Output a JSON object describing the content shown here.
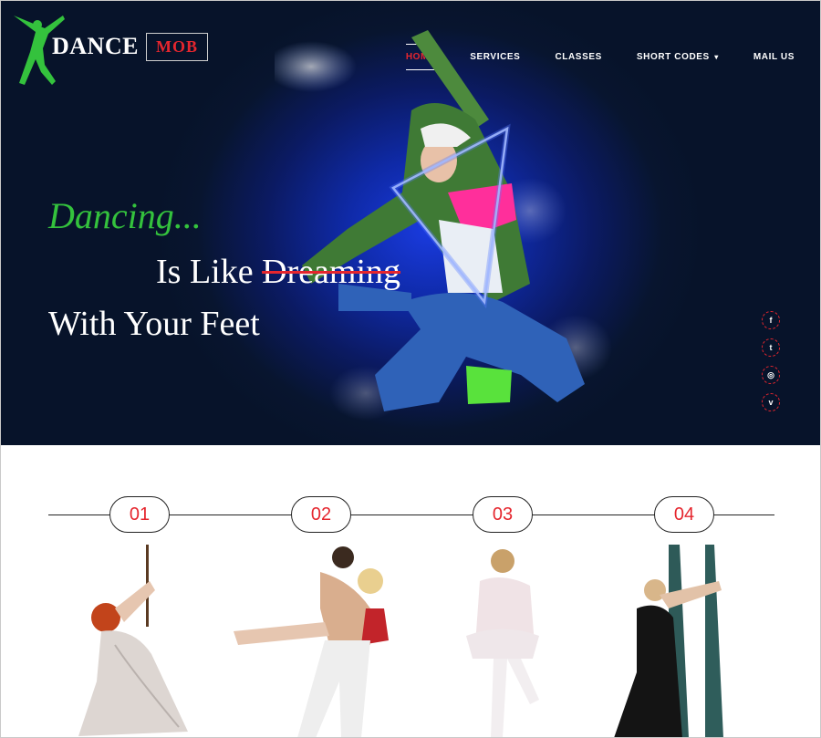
{
  "brand": {
    "name": "DANCE",
    "box": "MOB"
  },
  "nav": [
    {
      "label": "HOME",
      "active": true
    },
    {
      "label": "SERVICES",
      "active": false
    },
    {
      "label": "CLASSES",
      "active": false
    },
    {
      "label": "SHORT CODES",
      "active": false,
      "caret": "▾"
    },
    {
      "label": "MAIL US",
      "active": false
    }
  ],
  "hero": {
    "line1": "Dancing...",
    "line2_plain": "Is Like ",
    "line2_strike": "Dreaming",
    "line3": "With Your Feet"
  },
  "social": [
    {
      "icon": "facebook-icon",
      "glyph": "f"
    },
    {
      "icon": "twitter-icon",
      "glyph": "t"
    },
    {
      "icon": "dribbble-icon",
      "glyph": "◎"
    },
    {
      "icon": "vimeo-icon",
      "glyph": "v"
    }
  ],
  "steps": [
    "01",
    "02",
    "03",
    "04"
  ],
  "colors": {
    "accent": "#e5262e",
    "green": "#34c23d",
    "hero_bg": "#0b1a62"
  }
}
